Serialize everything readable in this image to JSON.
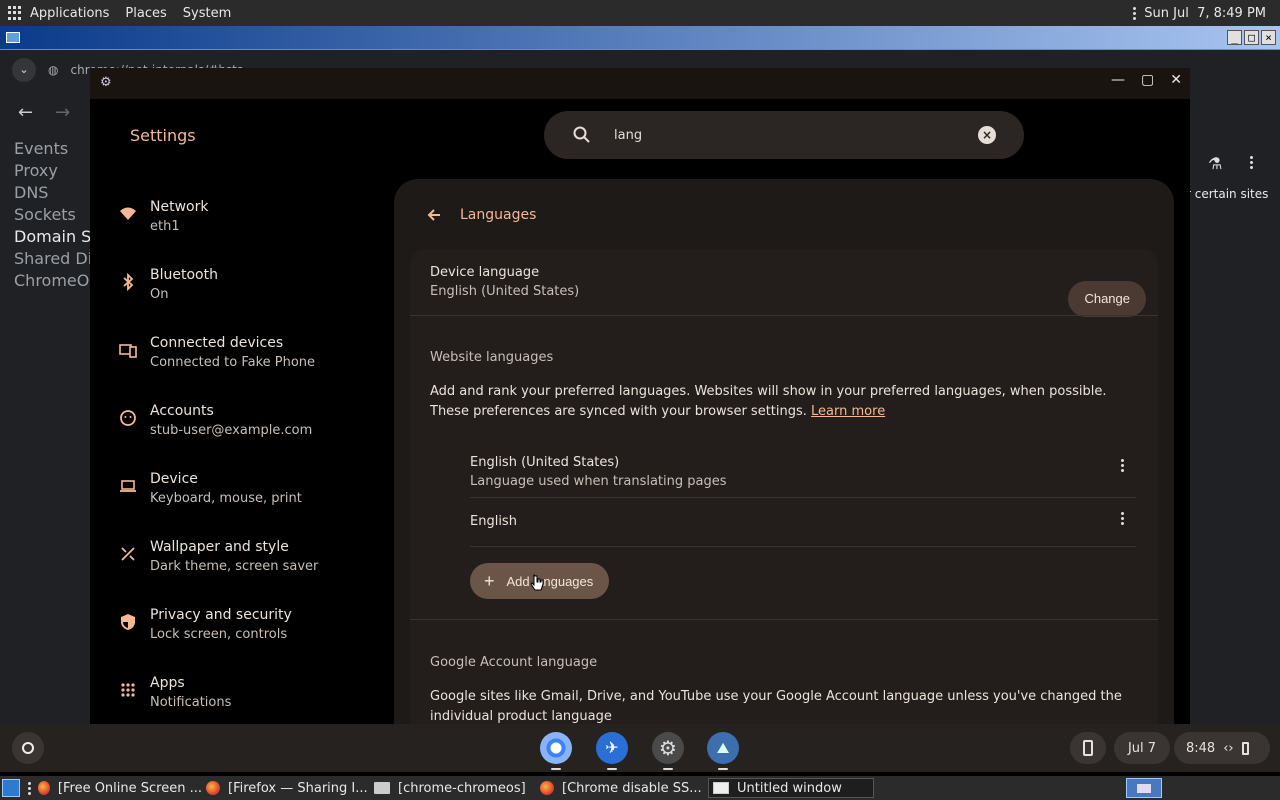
{
  "topbar": {
    "applications": "Applications",
    "places": "Places",
    "system": "System",
    "datetime": "Sun Jul  7, 8:49 PM"
  },
  "chrome_bg": {
    "tab_text": "chrome://net-internals/#hsts",
    "left_items": [
      "Events",
      "Proxy",
      "DNS",
      "Sockets",
      "Domain Se",
      "Shared Dic",
      "ChromeOS"
    ],
    "active_index": 4,
    "right_snippet": "r certain sites"
  },
  "settings": {
    "title": "Settings",
    "search": {
      "value": "lang",
      "clear_glyph": "×"
    },
    "sidebar": [
      {
        "title": "Network",
        "sub": "eth1",
        "icon": "wifi-icon"
      },
      {
        "title": "Bluetooth",
        "sub": "On",
        "icon": "bluetooth-icon"
      },
      {
        "title": "Connected devices",
        "sub": "Connected to Fake Phone",
        "icon": "phone-laptop-icon"
      },
      {
        "title": "Accounts",
        "sub": "stub-user@example.com",
        "icon": "account-icon"
      },
      {
        "title": "Device",
        "sub": "Keyboard, mouse, print",
        "icon": "laptop-icon"
      },
      {
        "title": "Wallpaper and style",
        "sub": "Dark theme, screen saver",
        "icon": "palette-icon"
      },
      {
        "title": "Privacy and security",
        "sub": "Lock screen, controls",
        "icon": "shield-icon"
      },
      {
        "title": "Apps",
        "sub": "Notifications",
        "icon": "apps-grid-icon"
      }
    ],
    "languages": {
      "header": "Languages",
      "device_language_label": "Device language",
      "device_language_value": "English (United States)",
      "change_label": "Change",
      "website_languages_title": "Website languages",
      "website_desc": "Add and rank your preferred languages. Websites will show in your preferred languages, when possible. These preferences are synced with your browser settings.",
      "learn_more": "Learn more",
      "lang_list": [
        {
          "name": "English (United States)",
          "sub": "Language used when translating pages"
        },
        {
          "name": "English",
          "sub": ""
        }
      ],
      "add_languages": "Add languages",
      "google_account_title": "Google Account language",
      "google_account_desc": "Google sites like Gmail, Drive, and YouTube use your Google Account language unless you've changed the individual product language"
    }
  },
  "shelf": {
    "date": "Jul 7",
    "time": "8:48"
  },
  "taskbar": {
    "items": [
      "[Free Online Screen ...",
      "[Firefox — Sharing I...",
      "[chrome-chromeos]",
      "[Chrome disable SS...",
      "Untitled window"
    ]
  },
  "colors": {
    "accent": "#f5b895",
    "panel": "#1e1a17",
    "card": "#231e1b",
    "add_button": "#6a5548"
  }
}
